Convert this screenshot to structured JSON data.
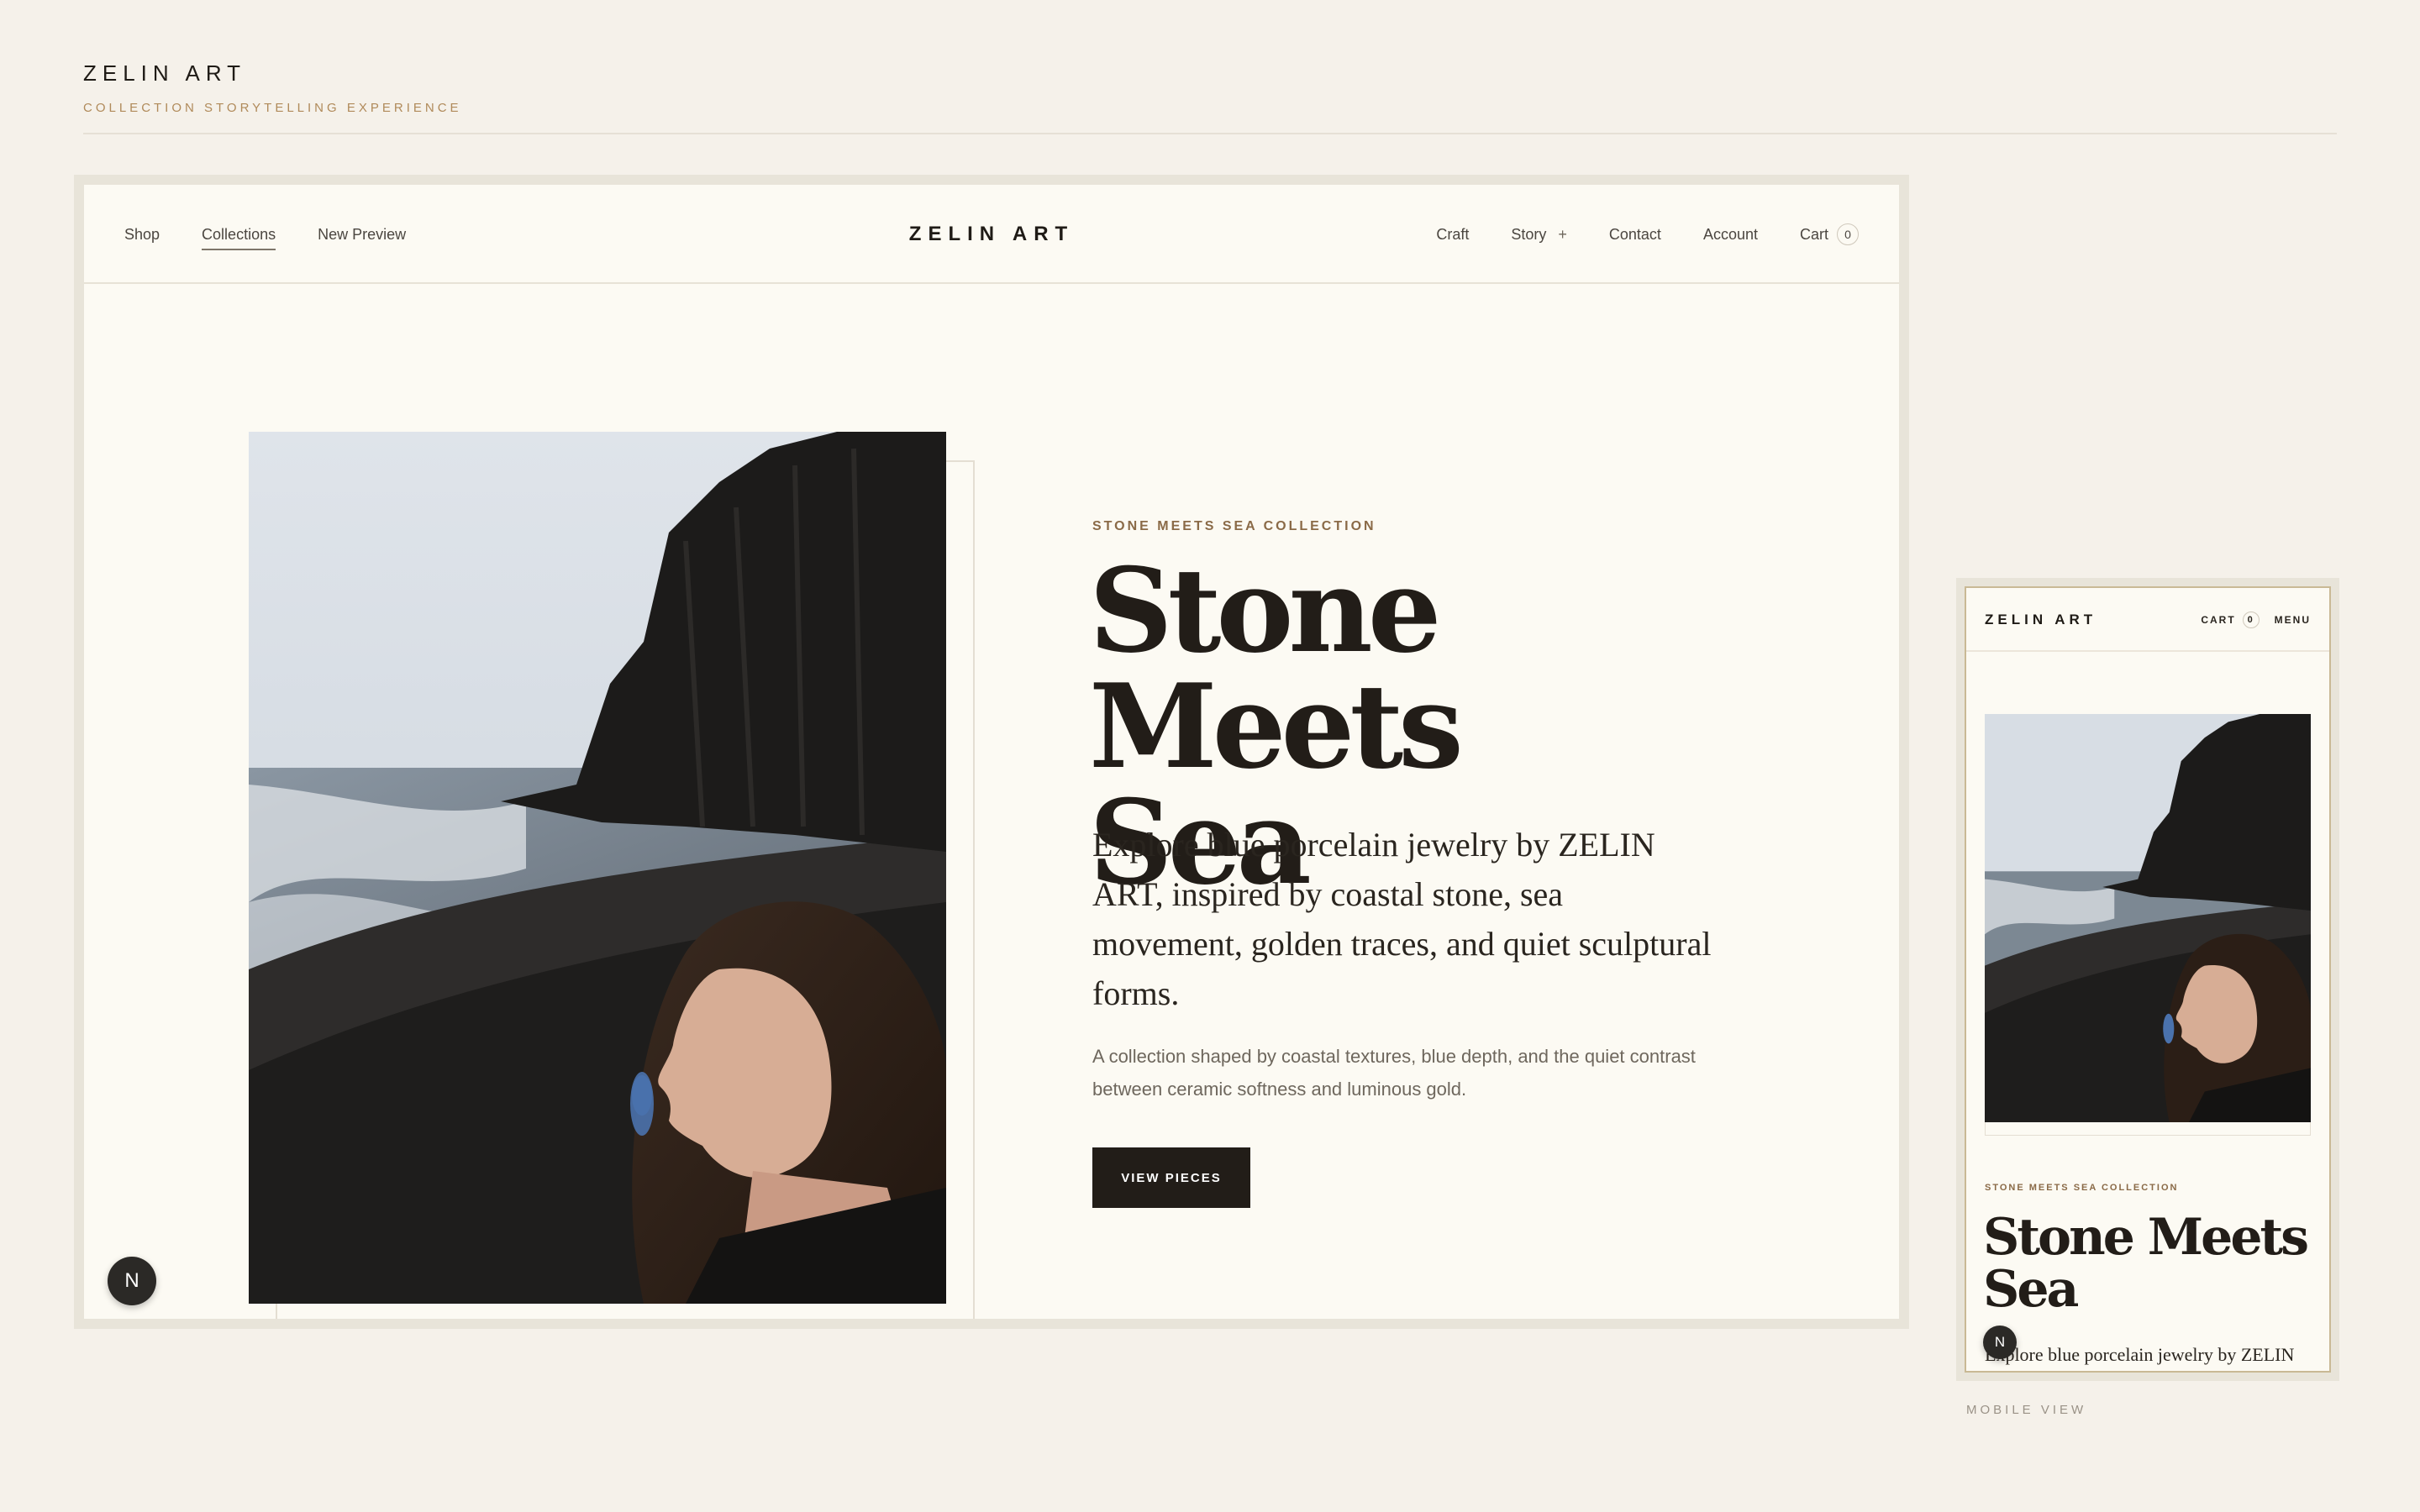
{
  "header": {
    "brand": "ZELIN ART",
    "subtitle": "COLLECTION STORYTELLING EXPERIENCE"
  },
  "desktop": {
    "nav": {
      "left": [
        "Shop",
        "Collections",
        "New Preview"
      ],
      "brand": "ZELIN ART",
      "craft": "Craft",
      "story": "Story",
      "story_plus": "+",
      "contact": "Contact",
      "account": "Account",
      "cart": "Cart",
      "cart_count": "0"
    },
    "hero": {
      "kicker": "STONE MEETS SEA COLLECTION",
      "title_line1": "Stone Meets",
      "title_line2": "Sea",
      "lead": "Explore blue porcelain jewelry by ZELIN ART, inspired by coastal stone, sea movement, golden traces, and quiet sculptural forms.",
      "description": "A collection shaped by coastal textures, blue depth, and the quiet contrast between ceramic softness and luminous gold.",
      "cta": "VIEW PIECES"
    },
    "badge": "N"
  },
  "mobile": {
    "brand": "ZELIN ART",
    "cart": "CART",
    "cart_count": "0",
    "menu": "MENU",
    "kicker": "STONE MEETS SEA COLLECTION",
    "title_line1": "Stone Meets",
    "title_line2": "Sea",
    "lead": "Explore blue porcelain jewelry by ZELIN ART, inspired by coastal stone, sea movement, golden traces, and quiet sculptural forms.",
    "badge": "N",
    "label": "MOBILE VIEW"
  },
  "colors": {
    "background": "#f5f1ea",
    "accent_gold": "#b08a5a",
    "ink": "#221d18"
  }
}
